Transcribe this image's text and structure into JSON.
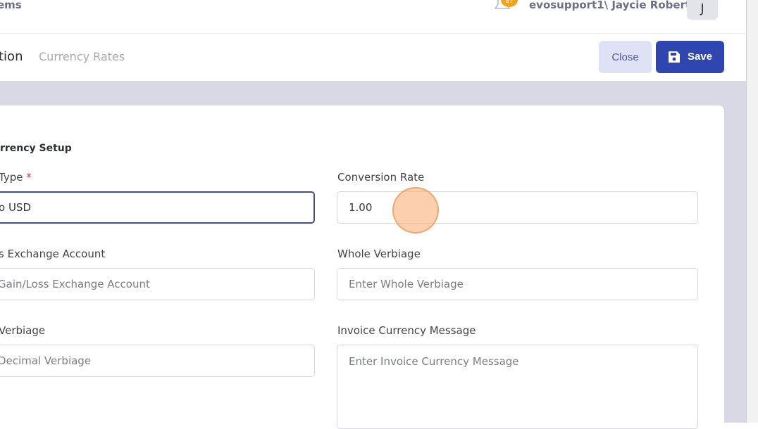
{
  "topbar": {
    "brand": "ems",
    "notification_count": "87",
    "user_name": "evosupport1\\ Jaycie Roberts",
    "avatar_initial": "J"
  },
  "subheader": {
    "active_tab": "tion",
    "inactive_tab": "Currency Rates",
    "close_label": "Close",
    "save_label": "Save"
  },
  "form": {
    "section_title": "urrency Setup",
    "type_label": " Type",
    "required_mark": "*",
    "type_value": "o USD",
    "conversion_label": "Conversion Rate",
    "conversion_value": "1.00",
    "exchange_label": "s Exchange Account",
    "exchange_placeholder": "Gain/Loss Exchange Account",
    "whole_label": "Whole Verbiage",
    "whole_placeholder": "Enter Whole Verbiage",
    "decimal_label": "Verbiage",
    "decimal_placeholder": "Decimal Verbiage",
    "invoice_label": "Invoice Currency Message",
    "invoice_placeholder": "Enter Invoice Currency Message"
  },
  "colors": {
    "primary": "#2f46b0",
    "close_bg": "#dfe1f4",
    "badge": "#f7a21b",
    "required": "#d9342b"
  }
}
